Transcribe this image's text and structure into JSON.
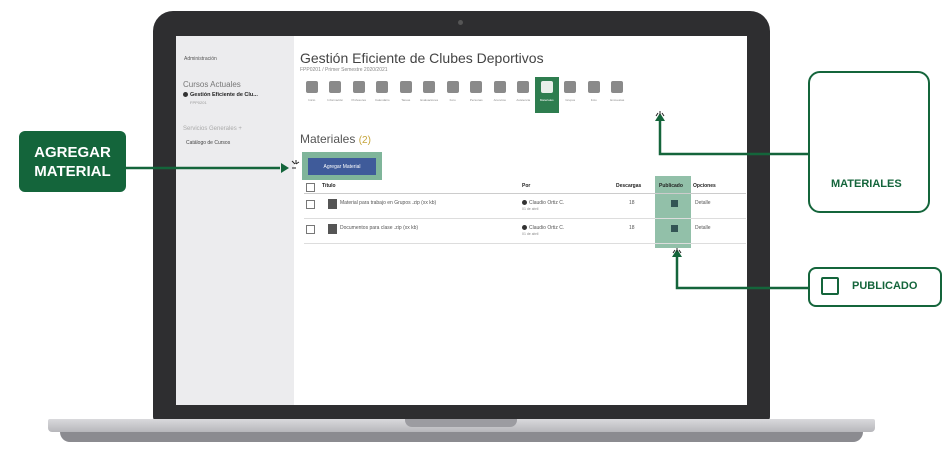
{
  "sidebar": {
    "admin": "Administración",
    "cursos_actuales": "Cursos Actuales",
    "course_name": "Gestión Eficiente de Clu...",
    "course_sub": "FPP0201",
    "servicios": "Servicios Generales +",
    "catalogo": "Catálogo de Cursos"
  },
  "header": {
    "title": "Gestión Eficiente de Clubes Deportivos",
    "subtitle": "FPP0201 / Primer Semestre 2020/2021"
  },
  "toolbar": {
    "items": [
      {
        "label": "Inicio",
        "icon": "home-icon"
      },
      {
        "label": "Información",
        "icon": "info-icon"
      },
      {
        "label": "Profesores",
        "icon": "teachers-icon"
      },
      {
        "label": "Calendario",
        "icon": "calendar-icon"
      },
      {
        "label": "Tareas",
        "icon": "tasks-icon"
      },
      {
        "label": "Evaluaciones",
        "icon": "evaluations-icon"
      },
      {
        "label": "Foro",
        "icon": "forum-icon"
      },
      {
        "label": "Personas",
        "icon": "people-icon"
      },
      {
        "label": "Anuncios",
        "icon": "announcements-icon"
      },
      {
        "label": "Asistencia",
        "icon": "attendance-icon"
      },
      {
        "label": "Materiales",
        "icon": "materials-icon"
      },
      {
        "label": "Grupos",
        "icon": "groups-icon"
      },
      {
        "label": "Foto",
        "icon": "photo-icon"
      },
      {
        "label": "Encuestas",
        "icon": "surveys-icon"
      }
    ]
  },
  "materials": {
    "heading": "Materiales",
    "count": "(2)",
    "add_button": "Agregar Material",
    "columns": [
      "Título",
      "Por",
      "Descargas",
      "Publicado",
      "Opciones"
    ],
    "rows": [
      {
        "title": "Material para trabajo en Grupos .zip (xx kb)",
        "author": "Claudio Ortiz C.",
        "date": "01 de abril",
        "downloads": "18",
        "option": "Detalle"
      },
      {
        "title": "Documentos para clase .zip (xx kb)",
        "author": "Claudio Ortiz C.",
        "date": "01 de abril",
        "downloads": "18",
        "option": "Detalle"
      }
    ]
  },
  "callouts": {
    "agregar_line1": "AGREGAR",
    "agregar_line2": "MATERIAL",
    "materiales": "MATERIALES",
    "publicado": "PUBLICADO"
  },
  "colors": {
    "callout_green": "#14653b",
    "highlight_green": "#7fb59a",
    "button_blue": "#3f5b9a"
  }
}
